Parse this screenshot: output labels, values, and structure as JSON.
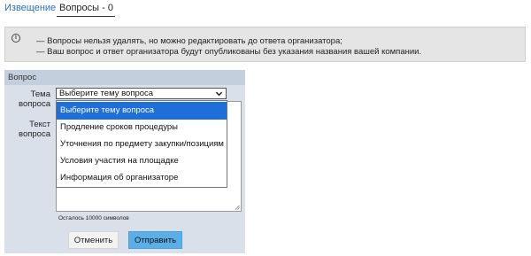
{
  "tabs": [
    {
      "label": "Извещение"
    },
    {
      "label": "Вопросы - 0"
    }
  ],
  "info": {
    "icon": "info-icon",
    "lines": [
      "— Вопросы нельзя удалять, но можно редактировать до ответа организатора;",
      "— Ваш вопрос и ответ организатора будут опубликованы без указания названия вашей компании."
    ]
  },
  "form": {
    "title": "Вопрос",
    "theme_label": "Тема вопроса",
    "text_label": "Текст вопроса",
    "select_value": "Выберите тему вопроса",
    "counter": "Осталось 10000 символов",
    "cancel_label": "Отменить",
    "submit_label": "Отправить"
  },
  "dropdown": {
    "options": [
      "Выберите тему вопроса",
      "Продление сроков процедуры",
      "Уточнения по предмету закупки/позициям",
      "Условия участия на площадке",
      "Информация об организаторе"
    ],
    "selected_index": 0
  },
  "colors": {
    "link": "#2a72b8",
    "panel": "#d9e0e9",
    "panel_header": "#c3cfdd",
    "submit": "#5aafe9",
    "option_selected": "#1e6fd9"
  }
}
